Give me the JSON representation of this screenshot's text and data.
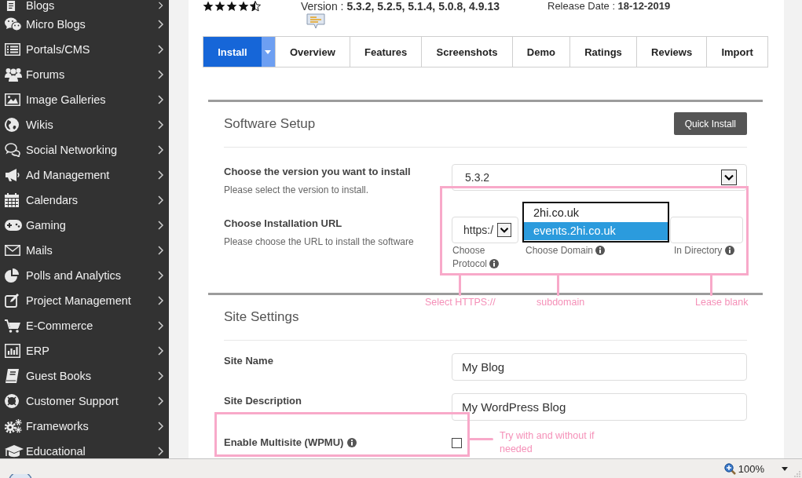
{
  "sidebar": {
    "items": [
      {
        "label": "Blogs"
      },
      {
        "label": "Micro Blogs"
      },
      {
        "label": "Portals/CMS"
      },
      {
        "label": "Forums"
      },
      {
        "label": "Image Galleries"
      },
      {
        "label": "Wikis"
      },
      {
        "label": "Social Networking"
      },
      {
        "label": "Ad Management"
      },
      {
        "label": "Calendars"
      },
      {
        "label": "Gaming"
      },
      {
        "label": "Mails"
      },
      {
        "label": "Polls and Analytics"
      },
      {
        "label": "Project Management"
      },
      {
        "label": "E-Commerce"
      },
      {
        "label": "ERP"
      },
      {
        "label": "Guest Books"
      },
      {
        "label": "Customer Support"
      },
      {
        "label": "Frameworks"
      },
      {
        "label": "Educational"
      }
    ]
  },
  "header": {
    "stars": 4.5,
    "version": "Version : **5.3.2, 5.2.5, 5.1.4, 5.0.8, 4.9.13**",
    "release_date": "Release Date : **18-12-2019**"
  },
  "tabs": [
    {
      "label": "Install",
      "selected": true,
      "menu": true
    },
    {
      "label": "Overview",
      "selected": false,
      "menu": false
    },
    {
      "label": "Features",
      "selected": false,
      "menu": false
    },
    {
      "label": "Screenshots",
      "selected": false,
      "menu": false
    },
    {
      "label": "Demo",
      "selected": false,
      "menu": false
    },
    {
      "label": "Ratings",
      "selected": false,
      "menu": false
    },
    {
      "label": "Reviews",
      "selected": false,
      "menu": false
    },
    {
      "label": "Import",
      "selected": false,
      "menu": false
    }
  ],
  "software_setup": {
    "title": "Software Setup",
    "button": "Quick Install",
    "version": {
      "label": "Choose the version you want to install",
      "hint": "Please select the version to install.",
      "value": "5.3.2"
    },
    "install_url": {
      "label": "Choose Installation URL",
      "hint": "Please choose the URL to install the software",
      "protocol": {
        "value": "https:/",
        "caption": "Choose Protocol"
      },
      "domain": {
        "caption": "Choose Domain",
        "expanded": true,
        "options": [
          {
            "label": "2hi.co.uk",
            "selected": false
          },
          {
            "label": "events.2hi.co.uk",
            "selected": true
          }
        ]
      },
      "directory": {
        "caption": "In Directory"
      }
    }
  },
  "site_settings": {
    "title": "Site Settings",
    "fields": [
      {
        "kind": "text",
        "label": "Site Name",
        "value": "My Blog",
        "info": false
      },
      {
        "kind": "text",
        "label": "Site Description",
        "value": "My WordPress Blog",
        "info": false
      },
      {
        "kind": "checkbox",
        "label": "Enable Multisite (WPMU)",
        "checked": false,
        "info": true
      }
    ]
  },
  "annotations": [
    {
      "text": "Select HTTPS://"
    },
    {
      "text": "subdomain"
    },
    {
      "text": "Lease blank"
    },
    {
      "text": "Try with and without if needed"
    }
  ],
  "status_bar": {
    "zoom": "100%"
  }
}
